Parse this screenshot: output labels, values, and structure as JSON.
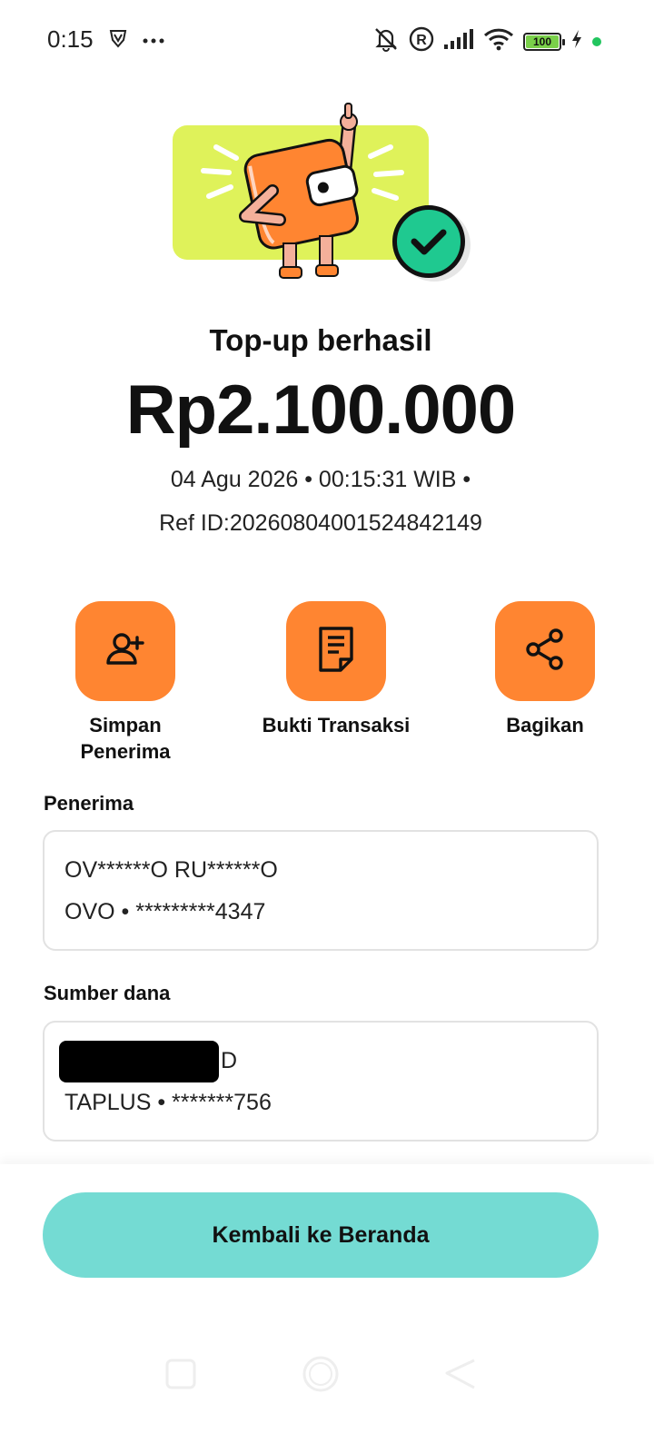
{
  "status_bar": {
    "time": "0:15",
    "battery": "100"
  },
  "result": {
    "title": "Top-up berhasil",
    "amount": "Rp2.100.000",
    "datetime": "04 Agu 2026 • 00:15:31 WIB •",
    "ref": "Ref ID:20260804001524842149"
  },
  "actions": [
    {
      "label": "Simpan Penerima",
      "icon": "add-user-icon"
    },
    {
      "label": "Bukti Transaksi",
      "icon": "receipt-icon"
    },
    {
      "label": "Bagikan",
      "icon": "share-icon"
    }
  ],
  "recipient": {
    "section_label": "Penerima",
    "name": "OV******O RU******O",
    "account": "OVO • *********4347"
  },
  "source": {
    "section_label": "Sumber dana",
    "name_suffix": "D",
    "account": "TAPLUS • *******756"
  },
  "bottom": {
    "home_button": "Kembali ke Beranda"
  },
  "colors": {
    "accent_orange": "#ff8531",
    "success_green": "#1fc990",
    "hero_lime": "#dff25a",
    "button_teal": "#74dbd3"
  }
}
